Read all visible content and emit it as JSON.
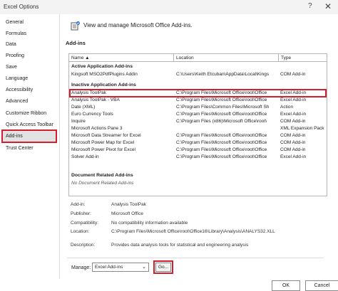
{
  "window": {
    "title": "Excel Options",
    "help_glyph": "?",
    "close_glyph": "✕"
  },
  "sidebar": {
    "items": [
      {
        "label": "General"
      },
      {
        "label": "Formulas"
      },
      {
        "label": "Data"
      },
      {
        "label": "Proofing"
      },
      {
        "label": "Save"
      },
      {
        "label": "Language"
      },
      {
        "label": "Accessibility"
      },
      {
        "label": "Advanced"
      },
      {
        "label": "Customize Ribbon"
      },
      {
        "label": "Quick Access Toolbar"
      },
      {
        "label": "Add-ins",
        "selected": true
      },
      {
        "label": "Trust Center"
      }
    ]
  },
  "main": {
    "header_text": "View and manage Microsoft Office Add-ins.",
    "header_icon": "addins-icon",
    "section_title": "Add-ins",
    "columns": [
      "Name ▲",
      "Location",
      "Type"
    ],
    "groups": [
      {
        "title": "Active Application Add-ins",
        "rows": [
          [
            "Kingsoft MSO2PdfPlugins Addin",
            "C:\\Users\\Keith Etcuban\\AppData\\Local\\Kings",
            "COM Add-in"
          ]
        ]
      },
      {
        "title": "Inactive Application Add-ins",
        "rows": [
          [
            "Analysis ToolPak",
            "C:\\Program Files\\Microsoft Office\\root\\Office",
            "Excel Add-in"
          ],
          [
            "Analysis ToolPak - VBA",
            "C:\\Program Files\\Microsoft Office\\root\\Office",
            "Excel Add-in"
          ],
          [
            "Date (XML)",
            "C:\\Program Files\\Common Files\\Microsoft Sh",
            "Action"
          ],
          [
            "Euro Currency Tools",
            "C:\\Program Files\\Microsoft Office\\root\\Office",
            "Excel Add-in"
          ],
          [
            "Inquire",
            "C:\\Program Files (x86)\\Microsoft Office\\root\\",
            "COM Add-in"
          ],
          [
            "Microsoft Actions Pane 3",
            "",
            "XML Expansion Pack"
          ],
          [
            "Microsoft Data Streamer for Excel",
            "C:\\Program Files\\Microsoft Office\\root\\Office",
            "COM Add-in"
          ],
          [
            "Microsoft Power Map for Excel",
            "C:\\Program Files\\Microsoft Office\\root\\Office",
            "COM Add-in"
          ],
          [
            "Microsoft Power Pivot for Excel",
            "C:\\Program Files\\Microsoft Office\\root\\Office",
            "COM Add-in"
          ],
          [
            "Solver Add-in",
            "C:\\Program Files\\Microsoft Office\\root\\Office",
            "Excel Add-in"
          ]
        ]
      },
      {
        "title": "Document Related Add-ins",
        "rows": [],
        "empty_text": "No Document Related Add-ins"
      }
    ]
  },
  "details": {
    "addin_label": "Add-in:",
    "addin_value": "Analysis ToolPak",
    "publisher_label": "Publisher:",
    "publisher_value": "Microsoft Office",
    "compat_label": "Compatibility:",
    "compat_value": "No compatibility information available",
    "location_label": "Location:",
    "location_value": "C:\\Program Files\\Microsoft Office\\root\\Office16\\Library\\Analysis\\ANALYS32.XLL",
    "description_label": "Description:",
    "description_value": "Provides data analysis tools for statistical and engineering analysis"
  },
  "manage": {
    "label": "Manage:",
    "selected": "Excel Add-ins",
    "go_label": "Go..."
  },
  "footer": {
    "ok": "OK",
    "cancel": "Cancel"
  },
  "colors": {
    "highlight": "#d11f2f",
    "selected_bg": "#e2e2e2"
  }
}
